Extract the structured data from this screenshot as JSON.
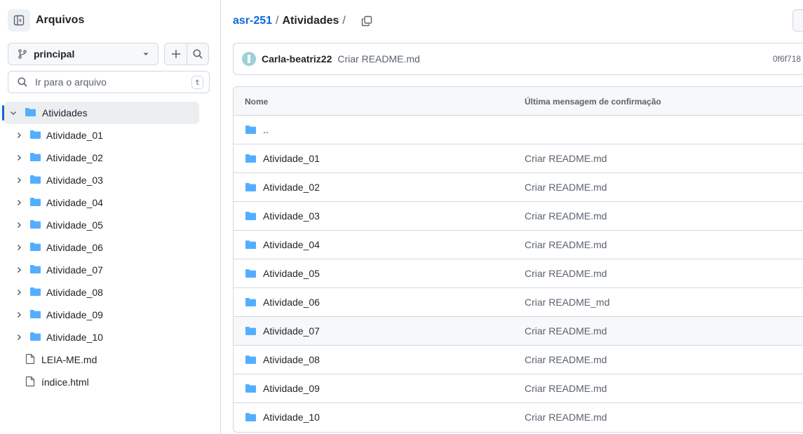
{
  "colors": {
    "accent": "#0969da",
    "folder": "#54aeff",
    "border": "#d1d9e0",
    "muted": "#59636e"
  },
  "sidebar": {
    "title": "Arquivos",
    "panel_icon": "sidebar-collapse-icon",
    "branch": {
      "label": "principal",
      "icon": "git-branch-icon"
    },
    "add_icon": "plus-icon",
    "search_icon": "search-icon",
    "file_search": {
      "placeholder": "Ir para o arquivo",
      "shortcut": "t"
    },
    "tree": {
      "root": "Atividades",
      "folders": [
        "Atividade_01",
        "Atividade_02",
        "Atividade_03",
        "Atividade_04",
        "Atividade_05",
        "Atividade_06",
        "Atividade_07",
        "Atividade_08",
        "Atividade_09",
        "Atividade_10"
      ],
      "files": [
        "LEIA-ME.md",
        "índice.html"
      ]
    }
  },
  "breadcrumb": {
    "repo": "asr-251",
    "sep1": "/",
    "folder": "Atividades",
    "sep2": "/"
  },
  "commit": {
    "author": "Carla-beatriz22",
    "message": "Criar README.md",
    "sha": "0f6f718"
  },
  "table": {
    "headers": {
      "name": "Nome",
      "message": "Última mensagem de confirmação"
    },
    "parent": "..",
    "rows": [
      {
        "name": "Atividade_01",
        "message": "Criar README.md"
      },
      {
        "name": "Atividade_02",
        "message": "Criar README.md"
      },
      {
        "name": "Atividade_03",
        "message": "Criar README.md"
      },
      {
        "name": "Atividade_04",
        "message": "Criar README.md"
      },
      {
        "name": "Atividade_05",
        "message": "Criar README.md"
      },
      {
        "name": "Atividade_06",
        "message": "Criar README_md"
      },
      {
        "name": "Atividade_07",
        "message": "Criar README.md"
      },
      {
        "name": "Atividade_08",
        "message": "Criar README.md"
      },
      {
        "name": "Atividade_09",
        "message": "Criar README.md"
      },
      {
        "name": "Atividade_10",
        "message": "Criar README.md"
      }
    ]
  }
}
